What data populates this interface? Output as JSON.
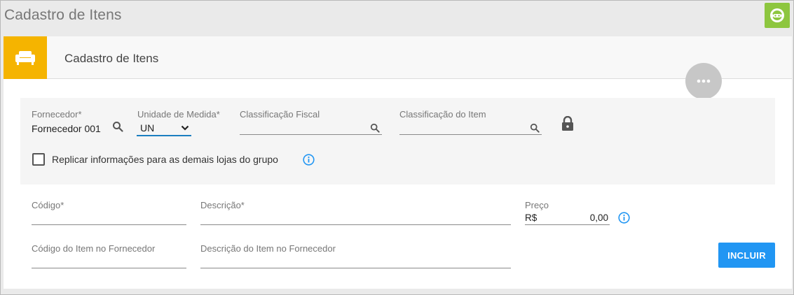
{
  "page": {
    "title": "Cadastro de Itens"
  },
  "card": {
    "title": "Cadastro de Itens"
  },
  "icons": {
    "help": "help-chat-icon",
    "header": "sofa-icon",
    "more": "more-icon",
    "lock": "lock-icon",
    "info": "info-icon",
    "search": "search-icon"
  },
  "colors": {
    "help": "#8dc63f",
    "header_icon_bg": "#f5b400",
    "primary": "#2196f3",
    "info": "#2196f3",
    "more_button": "#c7c7c7"
  },
  "form": {
    "fornecedor": {
      "label": "Fornecedor*",
      "value": "Fornecedor 001"
    },
    "unidade": {
      "label": "Unidade de Medida*",
      "value": "UN"
    },
    "classificacao_fiscal": {
      "label": "Classificação Fiscal",
      "value": ""
    },
    "classificacao_item": {
      "label": "Classificação do Item",
      "value": ""
    },
    "replicar": {
      "label": "Replicar informações para as demais lojas do grupo",
      "checked": false
    },
    "codigo": {
      "label": "Código*",
      "value": ""
    },
    "descricao": {
      "label": "Descrição*",
      "value": ""
    },
    "preco": {
      "label": "Preço",
      "currency": "R$",
      "value": "0,00"
    },
    "codigo_fornecedor": {
      "label": "Código do Item no Fornecedor",
      "value": ""
    },
    "descricao_fornecedor": {
      "label": "Descrição do Item no Fornecedor",
      "value": ""
    }
  },
  "actions": {
    "incluir": "INCLUIR"
  }
}
